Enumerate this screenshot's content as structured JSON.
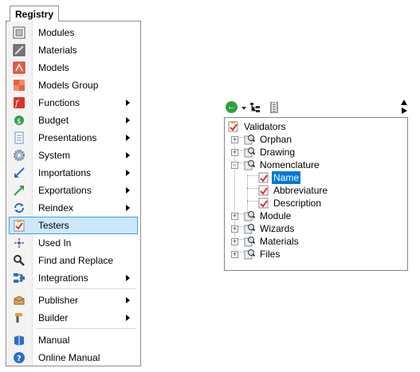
{
  "menu": {
    "tab_label": "Registry",
    "items": [
      {
        "label": "Modules",
        "icon": "modules-icon",
        "submenu": false
      },
      {
        "label": "Materials",
        "icon": "materials-icon",
        "submenu": false
      },
      {
        "label": "Models",
        "icon": "models-icon",
        "submenu": false
      },
      {
        "label": "Models Group",
        "icon": "models-group-icon",
        "submenu": false
      },
      {
        "label": "Functions",
        "icon": "functions-icon",
        "submenu": true
      },
      {
        "label": "Budget",
        "icon": "budget-icon",
        "submenu": true
      },
      {
        "label": "Presentations",
        "icon": "presentations-icon",
        "submenu": true
      },
      {
        "label": "System",
        "icon": "system-gear-icon",
        "submenu": true
      },
      {
        "label": "Importations",
        "icon": "importations-icon",
        "submenu": true
      },
      {
        "label": "Exportations",
        "icon": "exportations-icon",
        "submenu": true
      },
      {
        "label": "Reindex",
        "icon": "reindex-icon",
        "submenu": true
      },
      {
        "label": "Testers",
        "icon": "testers-icon",
        "submenu": false,
        "selected": true
      },
      {
        "label": "Used In",
        "icon": "used-in-icon",
        "submenu": false
      },
      {
        "label": "Find and Replace",
        "icon": "find-replace-icon",
        "submenu": false
      },
      {
        "label": "Integrations",
        "icon": "integrations-icon",
        "submenu": true
      },
      {
        "label": "Publisher",
        "icon": "publisher-icon",
        "submenu": true
      },
      {
        "label": "Builder",
        "icon": "builder-icon",
        "submenu": true
      },
      {
        "label": "Manual",
        "icon": "manual-book-icon",
        "submenu": false
      },
      {
        "label": "Online Manual",
        "icon": "help-icon",
        "submenu": false
      }
    ]
  },
  "tree": {
    "toolbar": {
      "back_icon": "back-arrow-icon",
      "tree_icon": "tree-view-icon",
      "expand_icon": "expand-all-icon"
    },
    "root": {
      "label": "Validators"
    },
    "nodes": [
      {
        "label": "Orphan",
        "expanded": false
      },
      {
        "label": "Drawing",
        "expanded": false
      },
      {
        "label": "Nomenclature",
        "expanded": true,
        "children": [
          "Name",
          "Abbreviature",
          "Description"
        ],
        "selected_child": "Name"
      },
      {
        "label": "Module",
        "expanded": false
      },
      {
        "label": "Wizards",
        "expanded": false
      },
      {
        "label": "Materials",
        "expanded": false
      },
      {
        "label": "Files",
        "expanded": false
      }
    ]
  },
  "colors": {
    "selection_bg": "#cce8ff",
    "selection_border": "#3d9ee8",
    "tree_selection": "#0078d7"
  }
}
